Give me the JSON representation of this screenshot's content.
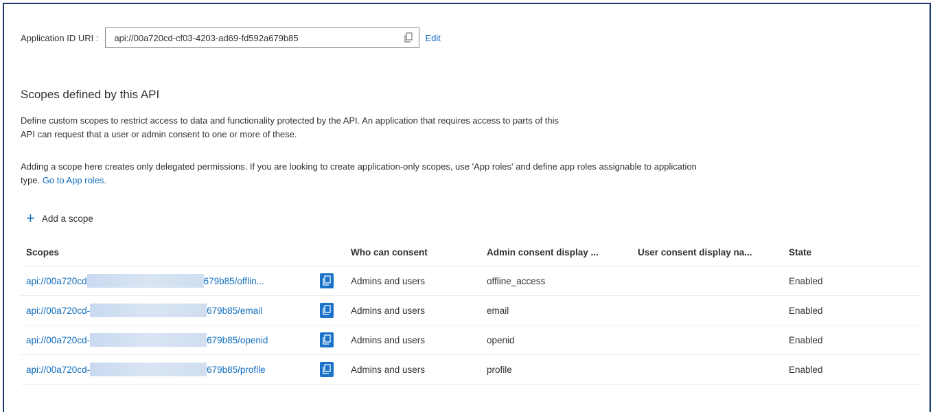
{
  "app_id_uri": {
    "label": "Application ID URI :",
    "value": "api://00a720cd-cf03-4203-ad69-fd592a679b85",
    "edit_label": "Edit"
  },
  "scopes_section": {
    "title": "Scopes defined by this API",
    "description_line1": "Define custom scopes to restrict access to data and functionality protected by the API. An application that requires access to parts of this",
    "description_line2": "API can request that a user or admin consent to one or more of these.",
    "description2": "Adding a scope here creates only delegated permissions. If you are looking to create application-only scopes, use 'App roles' and define app roles assignable to application",
    "description2_prefix": "type.",
    "app_roles_link": "Go to App roles.",
    "add_scope_label": "Add a scope"
  },
  "table": {
    "headers": [
      "Scopes",
      "Who can consent",
      "Admin consent display ...",
      "User consent display na...",
      "State"
    ],
    "rows": [
      {
        "scope_prefix": "api://00a720cd",
        "scope_suffix": "679b85/offlin...",
        "who": "Admins and users",
        "admin_display": "offline_access",
        "user_display": "",
        "state": "Enabled"
      },
      {
        "scope_prefix": "api://00a720cd-",
        "scope_suffix": "679b85/email",
        "who": "Admins and users",
        "admin_display": "email",
        "user_display": "",
        "state": "Enabled"
      },
      {
        "scope_prefix": "api://00a720cd-",
        "scope_suffix": "679b85/openid",
        "who": "Admins and users",
        "admin_display": "openid",
        "user_display": "",
        "state": "Enabled"
      },
      {
        "scope_prefix": "api://00a720cd-",
        "scope_suffix": "679b85/profile",
        "who": "Admins and users",
        "admin_display": "profile",
        "user_display": "",
        "state": "Enabled"
      }
    ]
  },
  "icons": {
    "copy": "copy-icon",
    "add": "plus-icon"
  },
  "colors": {
    "link": "#0f6cbd",
    "copy_button": "#1a73c8",
    "frame_border": "#1b3a6b"
  }
}
